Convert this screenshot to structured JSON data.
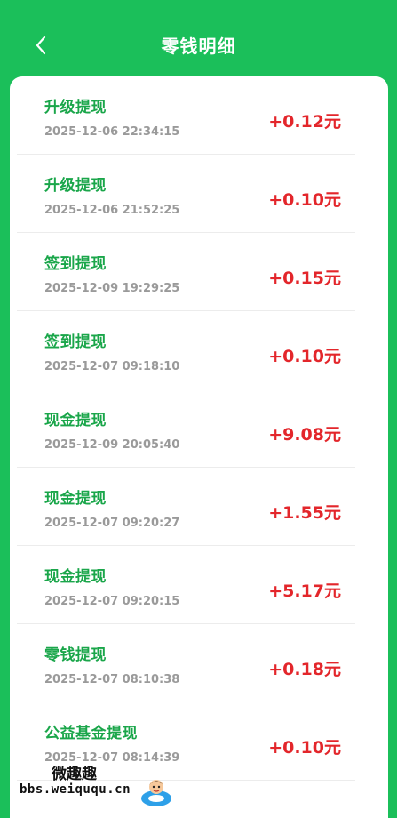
{
  "header": {
    "title": "零钱明细",
    "back_icon": "chevron-left-icon"
  },
  "colors": {
    "brand_green": "#1bbf5a",
    "label_green": "#1aa64a",
    "amount_red": "#e3262b",
    "time_gray": "#9a9a9a"
  },
  "records": [
    {
      "name": "升级提现",
      "time": "2025-12-06 22:34:15",
      "amount": "+0.12元"
    },
    {
      "name": "升级提现",
      "time": "2025-12-06 21:52:25",
      "amount": "+0.10元"
    },
    {
      "name": "签到提现",
      "time": "2025-12-09 19:29:25",
      "amount": "+0.15元"
    },
    {
      "name": "签到提现",
      "time": "2025-12-07 09:18:10",
      "amount": "+0.10元"
    },
    {
      "name": "现金提现",
      "time": "2025-12-09 20:05:40",
      "amount": "+9.08元"
    },
    {
      "name": "现金提现",
      "time": "2025-12-07 09:20:27",
      "amount": "+1.55元"
    },
    {
      "name": "现金提现",
      "time": "2025-12-07 09:20:15",
      "amount": "+5.17元"
    },
    {
      "name": "零钱提现",
      "time": "2025-12-07 08:10:38",
      "amount": "+0.18元"
    },
    {
      "name": "公益基金提现",
      "time": "2025-12-07 08:14:39",
      "amount": "+0.10元"
    }
  ],
  "watermark": {
    "title": "微趣趣",
    "url": "bbs.weiququ.cn",
    "mascot_icon": "mascot-icon"
  }
}
